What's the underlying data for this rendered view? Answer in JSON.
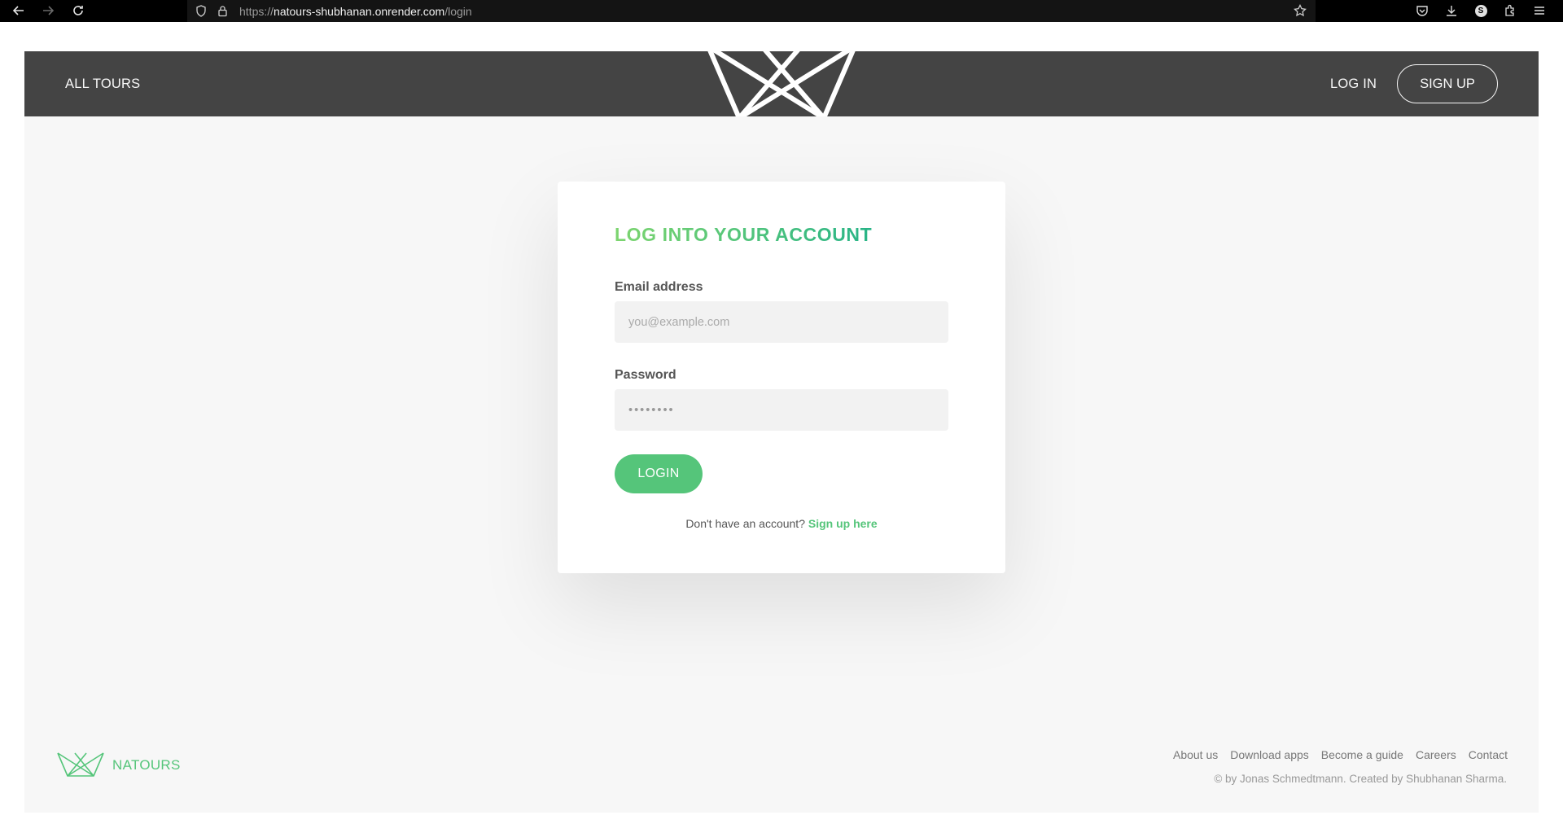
{
  "browser": {
    "url_scheme": "https://",
    "url_host": "natours-shubhanan.onrender.com",
    "url_path": "/login",
    "profile_letter": "S",
    "icons": [
      "back-arrow-icon",
      "forward-arrow-icon",
      "reload-icon",
      "shield-icon",
      "lock-icon",
      "bookmark-star-icon",
      "pocket-icon",
      "download-icon",
      "profile-icon",
      "extensions-icon",
      "menu-icon"
    ]
  },
  "header": {
    "all_tours": "ALL TOURS",
    "log_in": "LOG IN",
    "sign_up": "SIGN UP",
    "logo_icon": "natours-logo-icon"
  },
  "login_form": {
    "title": "LOG INTO YOUR ACCOUNT",
    "email_label": "Email address",
    "email_placeholder": "you@example.com",
    "email_value": "",
    "password_label": "Password",
    "password_placeholder": "••••••••",
    "password_value": "",
    "submit_label": "LOGIN",
    "no_account_text": "Don't have an account?",
    "signup_link": "Sign up here"
  },
  "footer": {
    "brand": "NATOURS",
    "links": [
      "About us",
      "Download apps",
      "Become a guide",
      "Careers",
      "Contact"
    ],
    "copyright": "© by Jonas Schmedtmann. Created by Shubhanan Sharma."
  },
  "colors": {
    "accent_green": "#55c57a",
    "gradient_start": "#7dd56f",
    "gradient_end": "#28b487",
    "header_bg": "#444444",
    "page_bg": "#f7f7f7"
  }
}
